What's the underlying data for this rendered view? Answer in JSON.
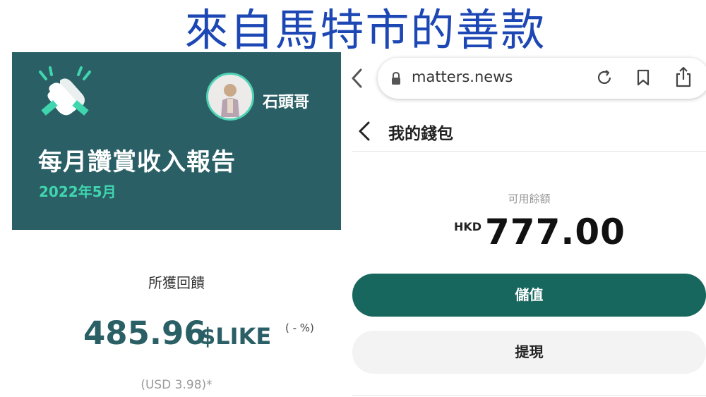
{
  "headline": "來自馬特市的善款",
  "report": {
    "author": "石頭哥",
    "title": "每月讚賞收入報告",
    "period": "2022年5月",
    "stats_label": "所獲回饋",
    "amount": "485.96",
    "unit": "$LIKE",
    "change": "( - %)",
    "usd": "(USD 3.98)*"
  },
  "browser": {
    "url": "matters.news",
    "icons": [
      "back-icon",
      "lock-icon",
      "reload-icon",
      "bookmark-icon",
      "share-icon"
    ]
  },
  "wallet": {
    "title": "我的錢包",
    "balance_label": "可用餘額",
    "currency": "HKD",
    "balance": "777.00",
    "topup_label": "儲值",
    "withdraw_label": "提現"
  },
  "colors": {
    "headline": "#1c47b4",
    "card_bg": "#2a5f66",
    "accent": "#3fd6ae",
    "primary_button": "#18675e",
    "secondary_button": "#f3f3f3"
  }
}
